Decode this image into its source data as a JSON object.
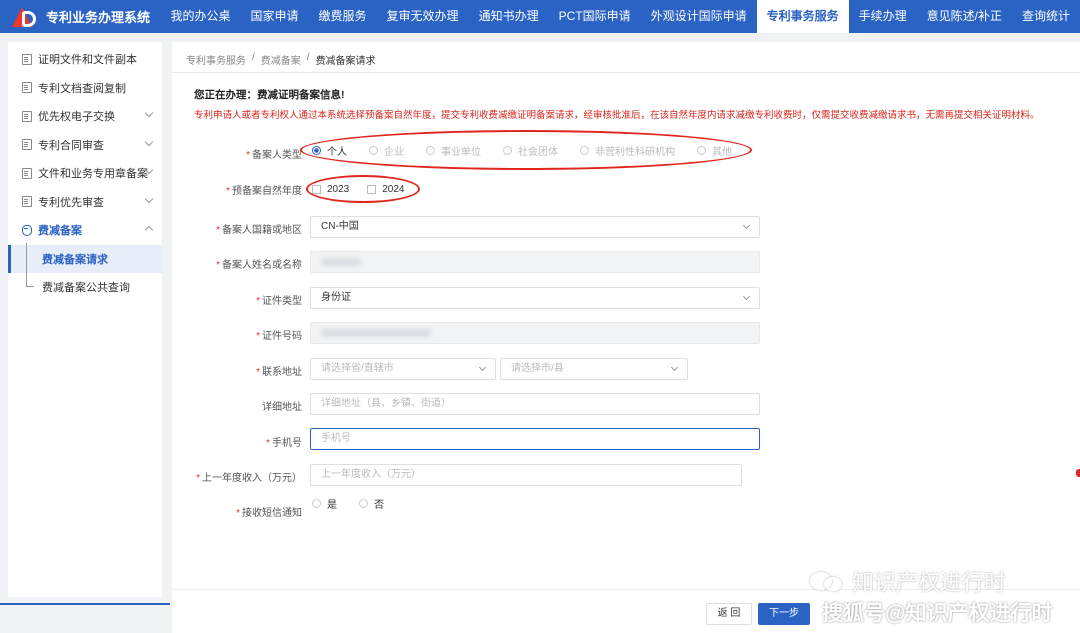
{
  "app": {
    "title": "专利业务办理系统"
  },
  "nav": [
    {
      "label": "我的办公桌",
      "active": false
    },
    {
      "label": "国家申请",
      "active": false
    },
    {
      "label": "缴费服务",
      "active": false
    },
    {
      "label": "复审无效办理",
      "active": false
    },
    {
      "label": "通知书办理",
      "active": false
    },
    {
      "label": "PCT国际申请",
      "active": false
    },
    {
      "label": "外观设计国际申请",
      "active": false
    },
    {
      "label": "专利事务服务",
      "active": true
    },
    {
      "label": "手续办理",
      "active": false
    },
    {
      "label": "意见陈述/补正",
      "active": false
    },
    {
      "label": "查询统计",
      "active": false
    }
  ],
  "sidebar": {
    "items": [
      {
        "label": "证明文件和文件副本"
      },
      {
        "label": "专利文档查阅复制"
      },
      {
        "label": "优先权电子交换"
      },
      {
        "label": "专利合同审查"
      },
      {
        "label": "文件和业务专用章备案"
      },
      {
        "label": "专利优先审查"
      },
      {
        "label": "费减备案"
      }
    ],
    "sub": [
      {
        "label": "费减备案请求"
      },
      {
        "label": "费减备案公共查询"
      }
    ]
  },
  "breadcrumb": [
    "专利事务服务",
    "/",
    "费减备案",
    "/",
    "费减备案请求"
  ],
  "notice": {
    "title": "您正在办理：费减证明备案信息!",
    "text": "专利申请人或者专利权人通过本系统选择预备案自然年度，提交专利收费减缴证明备案请求，经审核批准后，在该自然年度内请求减缴专利收费时，仅需提交收费减缴请求书，无需再提交相关证明材料。"
  },
  "form": {
    "filer_type": {
      "label": "备案人类型",
      "options": [
        "个人",
        "企业",
        "事业单位",
        "社会团体",
        "非营利性科研机构",
        "其他"
      ],
      "selected": "个人"
    },
    "year": {
      "label": "预备案自然年度",
      "options": [
        "2023",
        "2024"
      ]
    },
    "nationality": {
      "label": "备案人国籍或地区",
      "value": "CN-中国"
    },
    "name": {
      "label": "备案人姓名或名称"
    },
    "id_type": {
      "label": "证件类型",
      "value": "身份证"
    },
    "id_number": {
      "label": "证件号码"
    },
    "address": {
      "label": "联系地址",
      "province_placeholder": "请选择省/直辖市",
      "city_placeholder": "请选择市/县"
    },
    "address_detail": {
      "label": "详细地址",
      "placeholder": "详细地址（县、乡镇、街道）"
    },
    "phone": {
      "label": "手机号",
      "placeholder": "手机号"
    },
    "income": {
      "label": "上一年度收入（万元）",
      "placeholder": "上一年度收入（万元）"
    },
    "sms": {
      "label": "接收短信通知",
      "options": [
        "是",
        "否"
      ]
    }
  },
  "buttons": {
    "back": "返 回",
    "next": "下一步"
  },
  "watermark": {
    "line1": "知识产权进行时",
    "line2": "搜狐号@知识产权进行时"
  },
  "colors": {
    "primary": "#2b63c4",
    "notice_red": "#d9251c",
    "annotation_red": "#e0261d"
  }
}
